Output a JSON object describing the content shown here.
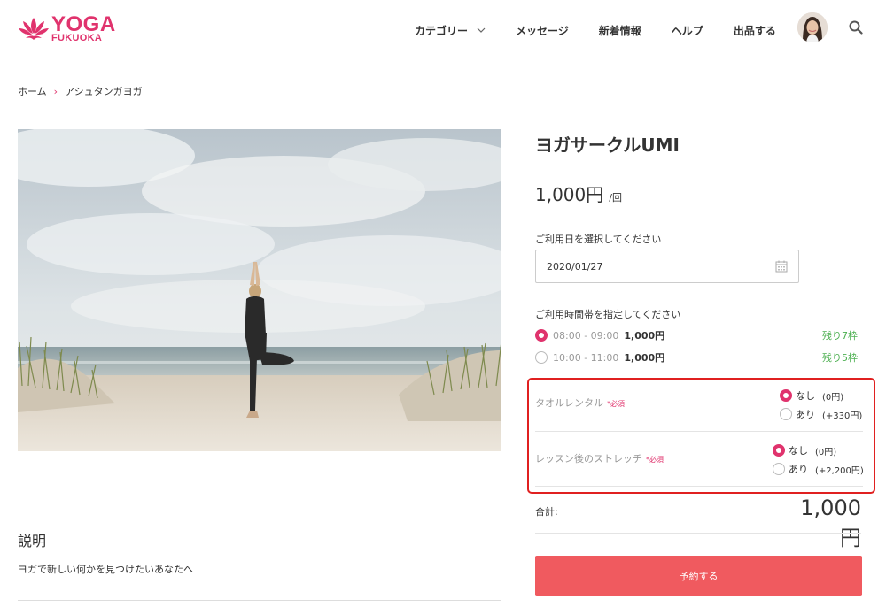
{
  "header": {
    "logo_main": "YOGA",
    "logo_sub": "FUKUOKA",
    "nav": [
      {
        "label": "カテゴリー",
        "has_dropdown": true
      },
      {
        "label": "メッセージ"
      },
      {
        "label": "新着情報"
      },
      {
        "label": "ヘルプ"
      },
      {
        "label": "出品する"
      }
    ],
    "icons": {
      "search": "search-icon",
      "avatar": "user-avatar",
      "dropdown": "chevron-down-icon"
    }
  },
  "breadcrumb": {
    "home": "ホーム",
    "separator": "›",
    "current": "アシュタンガヨガ"
  },
  "description": {
    "heading": "説明",
    "text": "ヨガで新しい何かを見つけたいあなたへ"
  },
  "product": {
    "title": "ヨガサークルUMI",
    "price": "1,000円",
    "price_unit": "/回"
  },
  "date": {
    "label": "ご利用日を選択してください",
    "value": "2020/01/27",
    "icon": "calendar-icon"
  },
  "time": {
    "label": "ご利用時間帯を指定してください",
    "slots": [
      {
        "time": "08:00 - 09:00",
        "price": "1,000円",
        "remaining": "残り7枠",
        "selected": true
      },
      {
        "time": "10:00 - 11:00",
        "price": "1,000円",
        "remaining": "残り5枠",
        "selected": false
      }
    ]
  },
  "options": [
    {
      "name": "タオルレンタル",
      "required": "*必須",
      "choices": [
        {
          "label": "なし",
          "price": "(0円)",
          "selected": true
        },
        {
          "label": "あり",
          "price": "(+330円)",
          "selected": false
        }
      ]
    },
    {
      "name": "レッスン後のストレッチ",
      "required": "*必須",
      "choices": [
        {
          "label": "なし",
          "price": "(0円)",
          "selected": true
        },
        {
          "label": "あり",
          "price": "(+2,200円)",
          "selected": false
        }
      ]
    }
  ],
  "total": {
    "label": "合計:",
    "value": "1,000円"
  },
  "reserve_button": "予約する",
  "colors": {
    "brand": "#e0336d",
    "button": "#f05a5f",
    "remaining": "#4caf50",
    "highlight_box": "#e02020"
  }
}
